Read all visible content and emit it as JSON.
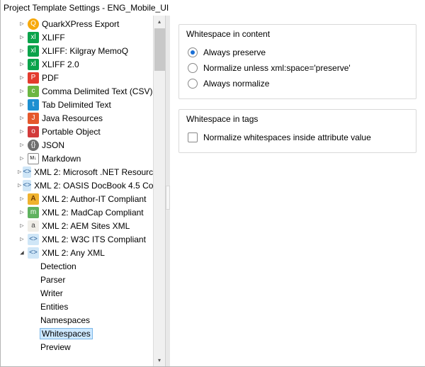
{
  "window": {
    "title": "Project Template Settings - ENG_Mobile_UI"
  },
  "tree": {
    "items": [
      {
        "indent": 1,
        "expand": "closed",
        "icon": "i-q",
        "label": "QuarkXPress Export"
      },
      {
        "indent": 1,
        "expand": "closed",
        "icon": "i-xl",
        "label": "XLIFF"
      },
      {
        "indent": 1,
        "expand": "closed",
        "icon": "i-xl",
        "label": "XLIFF: Kilgray MemoQ"
      },
      {
        "indent": 1,
        "expand": "closed",
        "icon": "i-xl",
        "label": "XLIFF 2.0"
      },
      {
        "indent": 1,
        "expand": "closed",
        "icon": "i-pdf",
        "label": "PDF"
      },
      {
        "indent": 1,
        "expand": "closed",
        "icon": "i-csv",
        "label": "Comma Delimited Text (CSV)"
      },
      {
        "indent": 1,
        "expand": "closed",
        "icon": "i-tab",
        "label": "Tab Delimited Text"
      },
      {
        "indent": 1,
        "expand": "closed",
        "icon": "i-jv",
        "label": "Java Resources"
      },
      {
        "indent": 1,
        "expand": "closed",
        "icon": "i-po",
        "label": "Portable Object"
      },
      {
        "indent": 1,
        "expand": "closed",
        "icon": "i-js",
        "label": "JSON"
      },
      {
        "indent": 1,
        "expand": "closed",
        "icon": "i-md",
        "label": "Markdown"
      },
      {
        "indent": 1,
        "expand": "closed",
        "icon": "i-xml",
        "label": "XML 2: Microsoft .NET Resourc"
      },
      {
        "indent": 1,
        "expand": "closed",
        "icon": "i-xml",
        "label": "XML 2: OASIS DocBook 4.5 Co"
      },
      {
        "indent": 1,
        "expand": "closed",
        "icon": "i-ai",
        "label": "XML 2: Author-IT Compliant"
      },
      {
        "indent": 1,
        "expand": "closed",
        "icon": "i-mc",
        "label": "XML 2: MadCap Compliant"
      },
      {
        "indent": 1,
        "expand": "closed",
        "icon": "i-ae",
        "label": "XML 2: AEM Sites XML"
      },
      {
        "indent": 1,
        "expand": "closed",
        "icon": "i-xml",
        "label": "XML 2: W3C ITS Compliant"
      },
      {
        "indent": 1,
        "expand": "open",
        "icon": "i-xml",
        "label": "XML 2: Any XML"
      },
      {
        "indent": 2,
        "expand": "none",
        "icon": "",
        "label": "Detection"
      },
      {
        "indent": 2,
        "expand": "none",
        "icon": "",
        "label": "Parser"
      },
      {
        "indent": 2,
        "expand": "none",
        "icon": "",
        "label": "Writer"
      },
      {
        "indent": 2,
        "expand": "none",
        "icon": "",
        "label": "Entities"
      },
      {
        "indent": 2,
        "expand": "none",
        "icon": "",
        "label": "Namespaces"
      },
      {
        "indent": 2,
        "expand": "none",
        "icon": "",
        "label": "Whitespaces",
        "selected": true
      },
      {
        "indent": 2,
        "expand": "none",
        "icon": "",
        "label": "Preview"
      }
    ],
    "icon_text": {
      "i-q": "Q",
      "i-xl": "xl",
      "i-pdf": "P",
      "i-csv": "c",
      "i-tab": "t",
      "i-jv": "J",
      "i-po": "o",
      "i-js": "{}",
      "i-md": "M↓",
      "i-xml": "<>",
      "i-ai": "A",
      "i-mc": "m",
      "i-ae": "a"
    }
  },
  "content_group": {
    "title": "Whitespace in content",
    "options": [
      {
        "label": "Always preserve",
        "checked": true
      },
      {
        "label": "Normalize unless xml:space='preserve'",
        "checked": false
      },
      {
        "label": "Always normalize",
        "checked": false
      }
    ]
  },
  "tags_group": {
    "title": "Whitespace in tags",
    "checkbox_label": "Normalize whitespaces inside attribute value",
    "checked": false
  }
}
